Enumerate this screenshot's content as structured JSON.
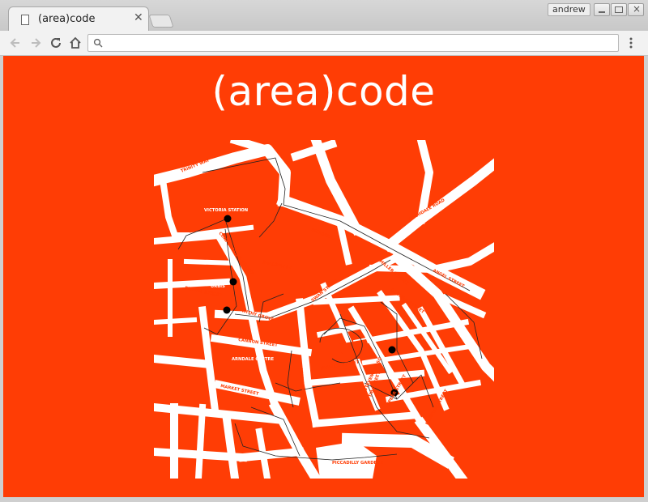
{
  "browser": {
    "tab_title": "(area)code",
    "user_name": "andrew",
    "address_value": "",
    "icons": {
      "favicon": "page-icon",
      "tab_close": "close-icon",
      "back": "arrow-left-icon",
      "forward": "arrow-right-icon",
      "reload": "reload-icon",
      "home": "home-icon",
      "omnibox": "search-icon",
      "menu": "kebab-menu-icon"
    }
  },
  "site": {
    "logo_text": "(area)code",
    "background_color": "#ff3d05",
    "map": {
      "street_color": "#ffffff",
      "label_color": "#ff3d05",
      "station_label": "VICTORIA STATION",
      "labels": [
        "TRINITY WAY",
        "VICTORIA STATION",
        "CORPORATION STREET",
        "BALLOON ST",
        "SHUDEHILL",
        "ROCHDALE ROAD",
        "ANGEL STREET",
        "MILLER STREET",
        "URBIS",
        "FENNEL STREET",
        "WITHY GROVE",
        "SWAN STREET",
        "CANNON STREET",
        "ARNDALE CENTRE",
        "MARKET STREET",
        "HIGH STREET",
        "CHURCH STREET",
        "TIB STREET",
        "OLDHAM STREET",
        "NEWTON STREET",
        "SPEAR STREET",
        "STEVENSON SQ",
        "PICCADILLY GARDENS"
      ]
    }
  }
}
